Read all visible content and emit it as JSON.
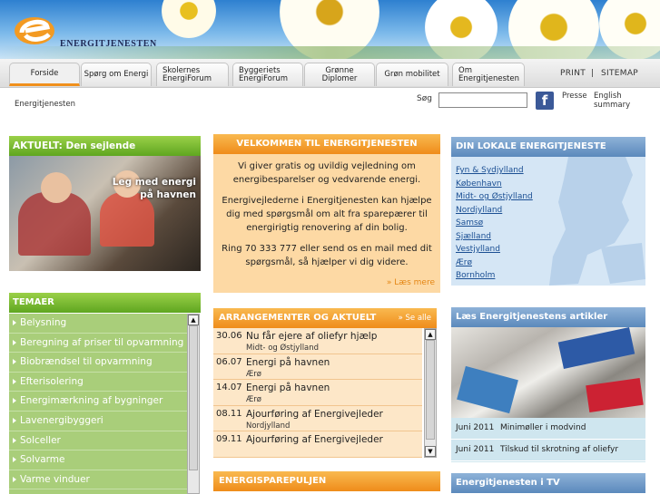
{
  "brand": {
    "name": "ENERGITJENESTEN",
    "logo_letter": "e"
  },
  "nav": {
    "tabs": [
      "Forside",
      "Spørg om Energi",
      "Skolernes EnergiForum",
      "Byggeriets EnergiForum",
      "Grønne Diplomer",
      "Grøn mobilitet",
      "Om Energitjenesten"
    ],
    "print": "PRINT",
    "separator": "|",
    "sitemap": "SITEMAP"
  },
  "breadcrumb": "Energitjenesten",
  "search": {
    "label": "Søg",
    "value": ""
  },
  "top_links": {
    "facebook": "f",
    "press": "Presse",
    "english": "English summary"
  },
  "aktuelt": {
    "title": "AKTUELT: Den sejlende Energitjeneste",
    "caption_line1": "Leg med energi",
    "caption_line2": "på havnen"
  },
  "themes": {
    "title": "TEMAER",
    "items": [
      "Belysning",
      "Beregning af priser til opvarmning",
      "Biobrændsel til opvarmning",
      "Efterisolering",
      "Energimærkning af bygninger",
      "Lavenergibyggeri",
      "Solceller",
      "Solvarme",
      "Varme vinduer"
    ]
  },
  "welcome": {
    "title": "VELKOMMEN TIL ENERGITJENESTEN",
    "p1": "Vi giver gratis og uvildig vejledning om energibesparelser og vedvarende energi.",
    "p2": "Energivejlederne i Energitjenesten kan hjælpe dig med spørgsmål om alt fra sparepærer til energirigtig renovering af din bolig.",
    "p3": "Ring 70 333 777 eller send os en mail med dit spørgsmål, så hjælper vi dig videre.",
    "more": "» Læs mere"
  },
  "events": {
    "title": "ARRANGEMENTER OG AKTUELT",
    "see_all": "» Se alle",
    "items": [
      {
        "date": "30.06",
        "title": "Nu får ejere af oliefyr hjælp",
        "sub": "Midt- og Østjylland"
      },
      {
        "date": "06.07",
        "title": "Energi på havnen",
        "sub": "Ærø"
      },
      {
        "date": "14.07",
        "title": "Energi på havnen",
        "sub": "Ærø"
      },
      {
        "date": "08.11",
        "title": "Ajourføring af Energivejleder",
        "sub": "Nordjylland"
      },
      {
        "date": "09.11",
        "title": "Ajourføring af Energivejleder",
        "sub": ""
      }
    ]
  },
  "energy_pool": {
    "title": "ENERGISPAREPULJEN"
  },
  "local": {
    "title": "DIN LOKALE ENERGITJENESTE",
    "regions": [
      "Fyn & Sydjylland",
      "København",
      "Midt- og Østjylland",
      "Nordjylland",
      "Samsø",
      "Sjælland",
      "Vestjylland",
      "Ærø",
      "Bornholm"
    ]
  },
  "articles": {
    "title": "Læs Energitjenestens artikler",
    "items": [
      {
        "date": "Juni 2011",
        "title": "Minimøller i modvind"
      },
      {
        "date": "Juni 2011",
        "title": "Tilskud til skrotning af oliefyr"
      }
    ]
  },
  "tv": {
    "title": "Energitjenesten i TV"
  },
  "colors": {
    "green": "#7cbc35",
    "orange": "#f39a22",
    "blue": "#6f9bcb",
    "link": "#1b4f93"
  }
}
